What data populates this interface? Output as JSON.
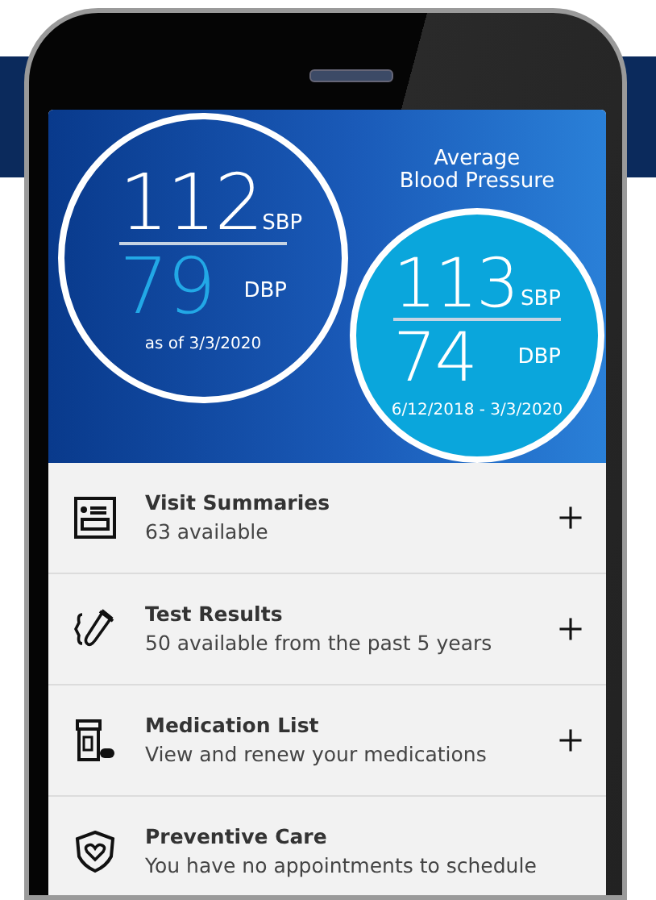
{
  "blood_pressure": [
    {
      "kind": "latest",
      "systolic": "112",
      "systolic_unit": "SBP",
      "diastolic": "79",
      "diastolic_unit": "DBP",
      "date": "as of 3/3/2020"
    },
    {
      "kind": "average",
      "title": "Average\nBlood Pressure",
      "systolic": "113",
      "systolic_unit": "SBP",
      "diastolic": "74",
      "diastolic_unit": "DBP",
      "date": "6/12/2018 - 3/3/2020"
    }
  ],
  "items": [
    {
      "kind": "visit",
      "title": "Visit Summaries",
      "subtitle": "63 available",
      "expandable": true
    },
    {
      "kind": "test",
      "title": "Test Results",
      "subtitle": "50 available from the past 5 years",
      "expandable": true
    },
    {
      "kind": "medication",
      "title": "Medication List",
      "subtitle": "View and renew your medications",
      "expandable": true
    },
    {
      "kind": "preventive",
      "title": "Preventive Care",
      "subtitle": "You have no appointments to schedule",
      "expandable": false
    }
  ]
}
